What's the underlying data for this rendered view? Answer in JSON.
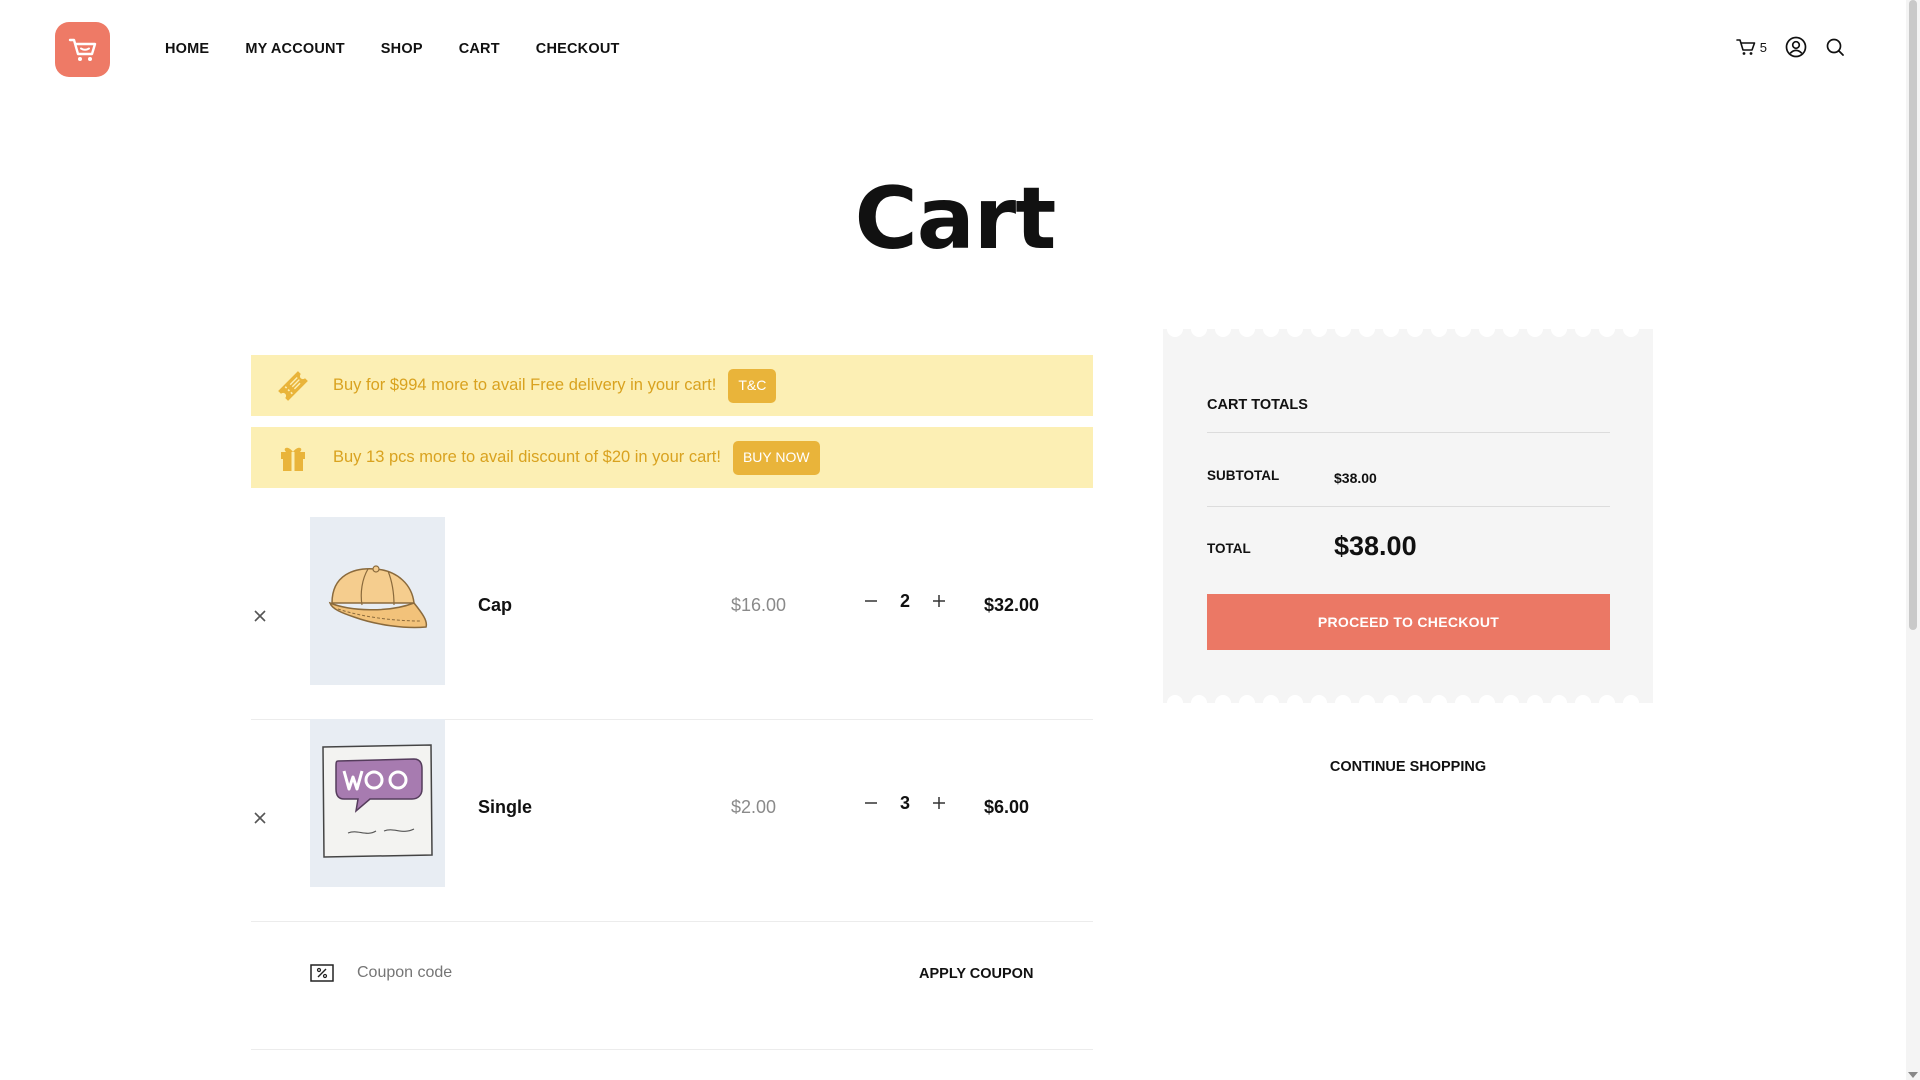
{
  "header": {
    "nav": [
      "HOME",
      "MY ACCOUNT",
      "SHOP",
      "CART",
      "CHECKOUT"
    ],
    "cart_count": "5",
    "icons": [
      "cart-icon",
      "account-icon",
      "search-icon"
    ]
  },
  "page_title": "Cart",
  "notices": [
    {
      "icon": "ticket-icon",
      "text": "Buy for $994 more to avail Free delivery in your cart!",
      "button": "T&C"
    },
    {
      "icon": "gift-icon",
      "text": "Buy 13 pcs more to avail discount of $20 in your cart!",
      "button": "BUY NOW"
    }
  ],
  "items": [
    {
      "name": "Cap",
      "price": "$16.00",
      "quantity": "2",
      "subtotal": "$32.00",
      "image": "cap"
    },
    {
      "name": "Single",
      "price": "$2.00",
      "quantity": "3",
      "subtotal": "$6.00",
      "image": "woo-single"
    }
  ],
  "coupon": {
    "placeholder": "Coupon code",
    "apply_label": "APPLY COUPON"
  },
  "totals": {
    "heading": "CART TOTALS",
    "subtotal_label": "SUBTOTAL",
    "subtotal_value": "$38.00",
    "total_label": "TOTAL",
    "total_value": "$38.00",
    "checkout_label": "PROCEED TO CHECKOUT"
  },
  "continue_label": "CONTINUE SHOPPING",
  "colors": {
    "brand": "#ee7a66",
    "checkout_button": "#eb7865",
    "notice_bg": "#fcefb4",
    "notice_text": "#d9a21f",
    "notice_button": "#e9b43a",
    "totals_bg": "#f5f5f5"
  }
}
